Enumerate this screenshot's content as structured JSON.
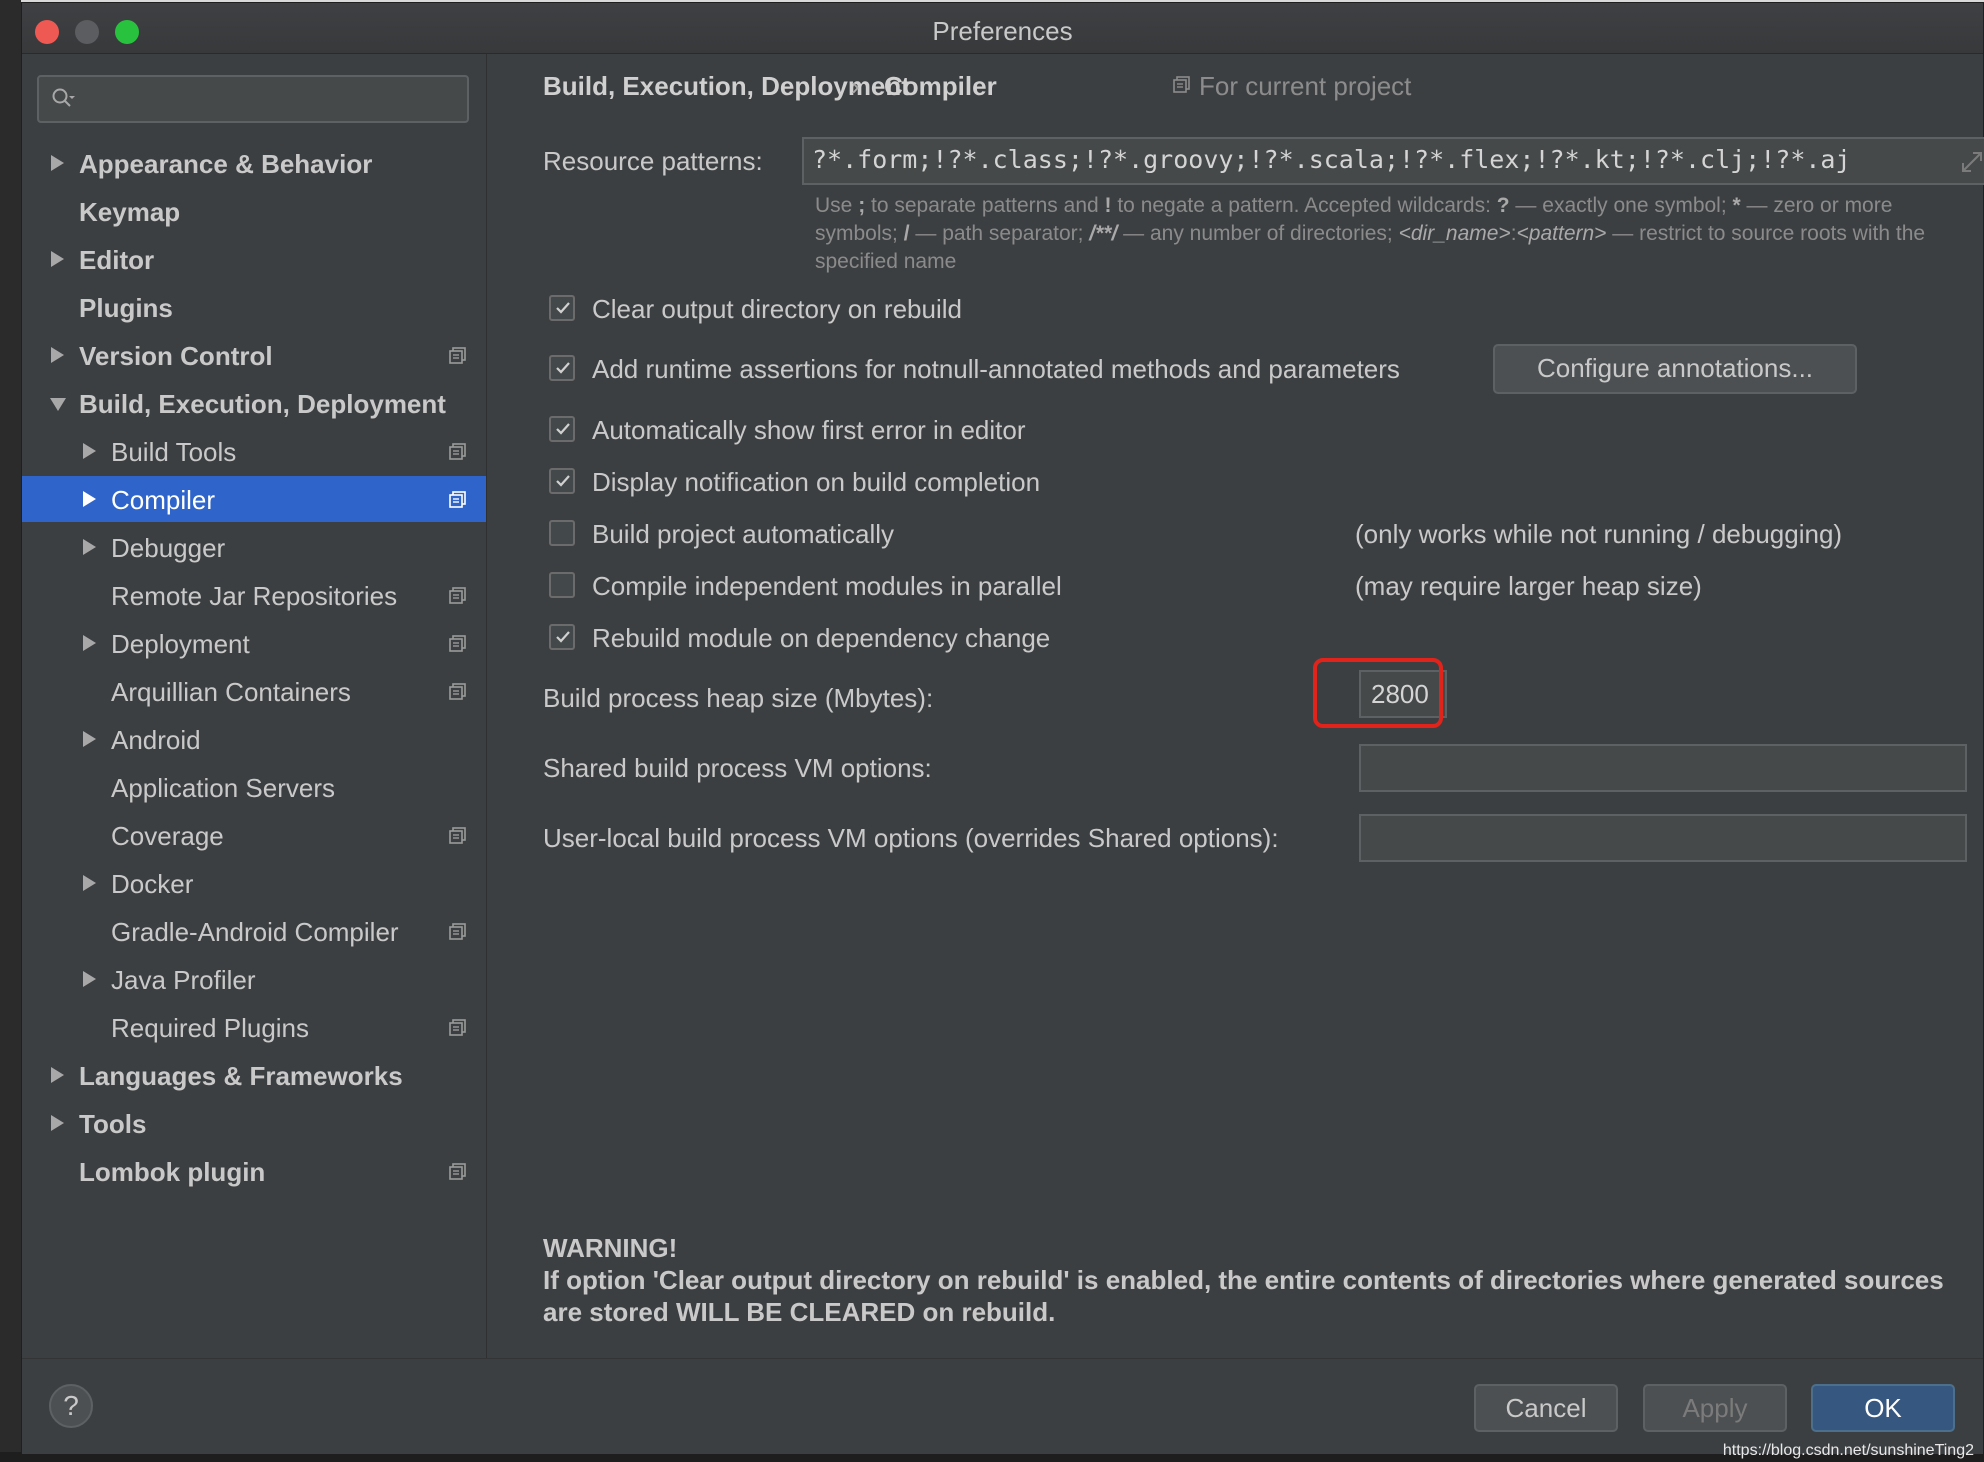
{
  "window": {
    "title": "Preferences"
  },
  "sidebar": {
    "search": {
      "value": "",
      "placeholder": ""
    },
    "items": [
      {
        "label": "Appearance & Behavior",
        "level": 0,
        "arrow": "right",
        "bold": true,
        "project": false,
        "selected": false
      },
      {
        "label": "Keymap",
        "level": 0,
        "arrow": "none",
        "bold": true,
        "project": false,
        "selected": false
      },
      {
        "label": "Editor",
        "level": 0,
        "arrow": "right",
        "bold": true,
        "project": false,
        "selected": false
      },
      {
        "label": "Plugins",
        "level": 0,
        "arrow": "none",
        "bold": true,
        "project": false,
        "selected": false
      },
      {
        "label": "Version Control",
        "level": 0,
        "arrow": "right",
        "bold": true,
        "project": true,
        "selected": false
      },
      {
        "label": "Build, Execution, Deployment",
        "level": 0,
        "arrow": "down",
        "bold": true,
        "project": false,
        "selected": false
      },
      {
        "label": "Build Tools",
        "level": 1,
        "arrow": "right",
        "bold": false,
        "project": true,
        "selected": false
      },
      {
        "label": "Compiler",
        "level": 1,
        "arrow": "right",
        "bold": false,
        "project": true,
        "selected": true
      },
      {
        "label": "Debugger",
        "level": 1,
        "arrow": "right",
        "bold": false,
        "project": false,
        "selected": false
      },
      {
        "label": "Remote Jar Repositories",
        "level": 1,
        "arrow": "none",
        "bold": false,
        "project": true,
        "selected": false
      },
      {
        "label": "Deployment",
        "level": 1,
        "arrow": "right",
        "bold": false,
        "project": true,
        "selected": false
      },
      {
        "label": "Arquillian Containers",
        "level": 1,
        "arrow": "none",
        "bold": false,
        "project": true,
        "selected": false
      },
      {
        "label": "Android",
        "level": 1,
        "arrow": "right",
        "bold": false,
        "project": false,
        "selected": false
      },
      {
        "label": "Application Servers",
        "level": 1,
        "arrow": "none",
        "bold": false,
        "project": false,
        "selected": false
      },
      {
        "label": "Coverage",
        "level": 1,
        "arrow": "none",
        "bold": false,
        "project": true,
        "selected": false
      },
      {
        "label": "Docker",
        "level": 1,
        "arrow": "right",
        "bold": false,
        "project": false,
        "selected": false
      },
      {
        "label": "Gradle-Android Compiler",
        "level": 1,
        "arrow": "none",
        "bold": false,
        "project": true,
        "selected": false
      },
      {
        "label": "Java Profiler",
        "level": 1,
        "arrow": "right",
        "bold": false,
        "project": false,
        "selected": false
      },
      {
        "label": "Required Plugins",
        "level": 1,
        "arrow": "none",
        "bold": false,
        "project": true,
        "selected": false
      },
      {
        "label": "Languages & Frameworks",
        "level": 0,
        "arrow": "right",
        "bold": true,
        "project": false,
        "selected": false
      },
      {
        "label": "Tools",
        "level": 0,
        "arrow": "right",
        "bold": true,
        "project": false,
        "selected": false
      },
      {
        "label": "Lombok plugin",
        "level": 0,
        "arrow": "none",
        "bold": true,
        "project": true,
        "selected": false
      }
    ]
  },
  "breadcrumb": {
    "parent": "Build, Execution, Deployment",
    "separator": "›",
    "current": "Compiler",
    "scope": "For current project"
  },
  "resource": {
    "label": "Resource patterns:",
    "value": "?*.form;!?*.class;!?*.groovy;!?*.scala;!?*.flex;!?*.kt;!?*.clj;!?*.aj",
    "hint": {
      "p1": "Use ",
      "semi": ";",
      "p2": " to separate patterns and ",
      "bang": "!",
      "p3": " to negate a pattern. Accepted wildcards: ",
      "q": "?",
      "p4": " — exactly one symbol; ",
      "star": "*",
      "p5": " — zero or more symbols; ",
      "slash": "/",
      "p6": " — path separator; ",
      "dstar": "/**/",
      "p7": " — any number of directories; ",
      "dirname": "<dir_name>",
      "colon": ":",
      "pattern": "<pattern>",
      "p8": " — restrict to source roots with the specified name"
    }
  },
  "options": {
    "clear_output": {
      "label": "Clear output directory on rebuild",
      "checked": true
    },
    "runtime_assertions": {
      "label": "Add runtime assertions for notnull-annotated methods and parameters",
      "checked": true
    },
    "configure_button": "Configure annotations...",
    "show_first_error": {
      "label": "Automatically show first error in editor",
      "checked": true
    },
    "display_notification": {
      "label": "Display notification on build completion",
      "checked": true
    },
    "build_auto": {
      "label": "Build project automatically",
      "checked": false,
      "note": "(only works while not running / debugging)"
    },
    "compile_parallel": {
      "label": "Compile independent modules in parallel",
      "checked": false,
      "note": "(may require larger heap size)"
    },
    "rebuild_on_change": {
      "label": "Rebuild module on dependency change",
      "checked": true
    }
  },
  "heap": {
    "label": "Build process heap size (Mbytes):",
    "value": "2800"
  },
  "shared_vm": {
    "label": "Shared build process VM options:",
    "value": ""
  },
  "user_vm": {
    "label": "User-local build process VM options (overrides Shared options):",
    "value": ""
  },
  "warning": {
    "title": "WARNING!",
    "body": "If option 'Clear output directory on rebuild' is enabled, the entire contents of directories where generated sources are stored WILL BE CLEARED on rebuild."
  },
  "footer": {
    "help": "?",
    "cancel": "Cancel",
    "apply": "Apply",
    "ok": "OK"
  },
  "watermark": "https://blog.csdn.net/sunshineTing2",
  "colors": {
    "background": "#3c3f41",
    "selection": "#2f65ca",
    "primary_button": "#365880",
    "highlight": "#e0231b"
  }
}
